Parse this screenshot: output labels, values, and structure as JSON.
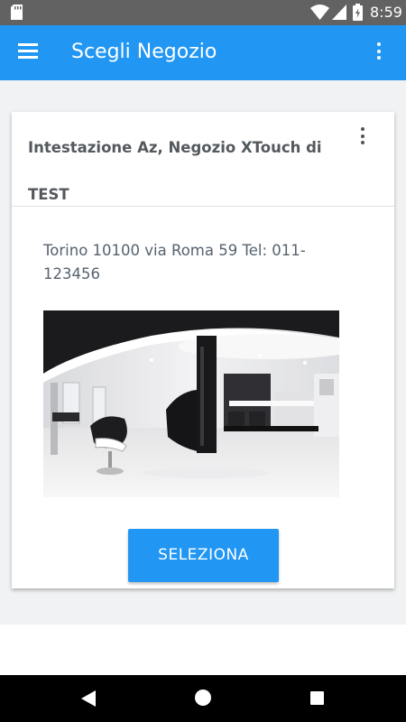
{
  "status_bar": {
    "time": "8:59",
    "icons": [
      "sd-card-icon",
      "wifi-icon",
      "signal-icon",
      "battery-charging-icon"
    ]
  },
  "app_bar": {
    "title": "Scegli Negozio",
    "menu_icon": "hamburger-menu-icon",
    "overflow_icon": "more-vert-icon",
    "color": "#2196f3"
  },
  "store_card": {
    "title": "Intestazione Az, Negozio XTouch di TEST",
    "address": "Torino 10100 via Roma 59    Tel: 011-123456",
    "image": "salon-interior-photo",
    "select_label": "SELEZIONA",
    "overflow_icon": "more-vert-icon"
  },
  "nav_bar": {
    "icons": [
      "back-icon",
      "home-icon",
      "recents-icon"
    ]
  }
}
